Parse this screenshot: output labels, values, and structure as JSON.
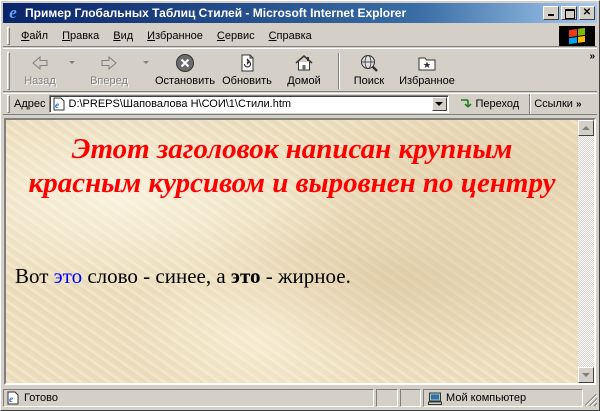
{
  "window": {
    "title": "Пример Глобальных Таблиц Стилей - Microsoft Internet Explorer",
    "min_label": "",
    "max_label": "",
    "close_label": "✕"
  },
  "menu": {
    "items": [
      {
        "ul": "Ф",
        "rest": "айл"
      },
      {
        "ul": "П",
        "rest": "равка"
      },
      {
        "ul": "В",
        "rest": "ид"
      },
      {
        "ul": "И",
        "rest": "збранное"
      },
      {
        "ul": "С",
        "rest": "ервис"
      },
      {
        "ul": "С",
        "rest": "правка"
      }
    ]
  },
  "toolbar": {
    "back": "Назад",
    "forward": "Вперед",
    "stop": "Остановить",
    "refresh": "Обновить",
    "home": "Домой",
    "search": "Поиск",
    "favorites": "Избранное",
    "chevron": "»"
  },
  "address": {
    "label": "Адрес",
    "value": "D:\\PREPS\\Шаповалова Н\\СОИ\\1\\Стили.htm",
    "go": "Переход",
    "links": "Ссылки",
    "links_chevron": "»"
  },
  "content": {
    "heading": "Этот заголовок написан крупным красным курсивом и выровнен по центру",
    "para_start": "Вот ",
    "para_blue": "это",
    "para_mid": " слово - синее, а ",
    "para_bold": "это",
    "para_end": " - жирное."
  },
  "status": {
    "text": "Готово",
    "zone": "Мой компьютер"
  },
  "colors": {
    "heading": "#ff0000",
    "blue_word": "#0000ff",
    "titlebar_start": "#0a246a",
    "titlebar_end": "#a6caf0"
  }
}
